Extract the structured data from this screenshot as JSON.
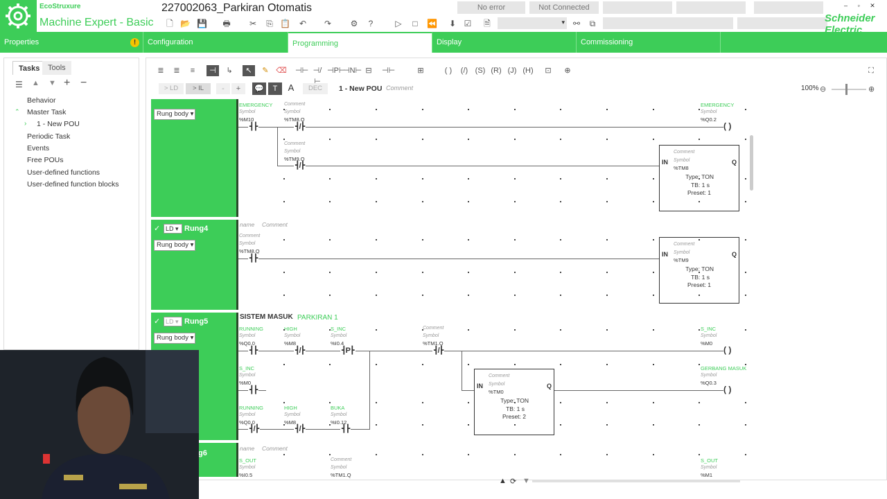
{
  "app": {
    "brand": "EcoStruxure",
    "product": "Machine Expert - Basic",
    "project_title": "227002063_Parkiran Otomatis",
    "status_error": "No error",
    "status_connection": "Not Connected",
    "vendor": "Schneider Electric",
    "accent": "#3dcd58"
  },
  "nav": {
    "tabs": [
      "Properties",
      "Configuration",
      "Programming",
      "Display",
      "Commissioning"
    ],
    "active": "Programming"
  },
  "left": {
    "tabs": [
      "Tasks",
      "Tools"
    ],
    "tree": [
      "Behavior",
      "Master Task",
      "1 - New POU",
      "Periodic Task",
      "Events",
      "Free POUs",
      "User-defined functions",
      "User-defined function blocks"
    ]
  },
  "editor": {
    "pou_title": "1 - New POU",
    "pou_comment": "Comment",
    "btn_ld": "> LD",
    "btn_il": "> IL",
    "btn_dec": "DEC",
    "zoom": "100%"
  },
  "rungs": {
    "rung4": {
      "name": "Rung4",
      "mode": "LD",
      "body": "Rung body",
      "name_ph": "name",
      "comment_ph": "Comment"
    },
    "rung5": {
      "name": "Rung5",
      "mode": "LD",
      "body": "Rung body",
      "title": "SISTEM MASUK",
      "subtitle": "PARKIRAN 1"
    },
    "rung6": {
      "name": "g6",
      "name_ph": "name",
      "comment_ph": "Comment"
    },
    "rung3": {
      "body": "Rung body"
    }
  },
  "labels": {
    "symbol": "Symbol",
    "comment": "Comment",
    "emergency": "EMERGENCY",
    "running": "RUNNING",
    "high": "HIGH",
    "s_inc": "S_INC",
    "buka": "BUKA",
    "gerbang_masuk": "GERBANG MASUK",
    "s_out": "S_OUT",
    "in": "IN",
    "q": "Q",
    "type_ton": "Type: TON",
    "tb_1s": "TB: 1 s",
    "preset_1": "Preset: 1",
    "preset_2": "Preset: 2"
  },
  "addr": {
    "m10": "%M10",
    "tm8q": "%TM8.Q",
    "tm9q": "%TM9.Q",
    "q02": "%Q0.2",
    "tm8": "%TM8",
    "tm9": "%TM9",
    "q00": "%Q0.0",
    "m8": "%M8",
    "i04": "%I0.4",
    "tm1q": "%TM1.Q",
    "m0": "%M0",
    "tm0": "%TM0",
    "q03": "%Q0.3",
    "i012": "%I0.12",
    "i05": "%I0.5",
    "m1": "%M1",
    "tm8q2": "%TM8.Q",
    "q00b": "%Q0.0",
    "m8b": "%M8"
  }
}
